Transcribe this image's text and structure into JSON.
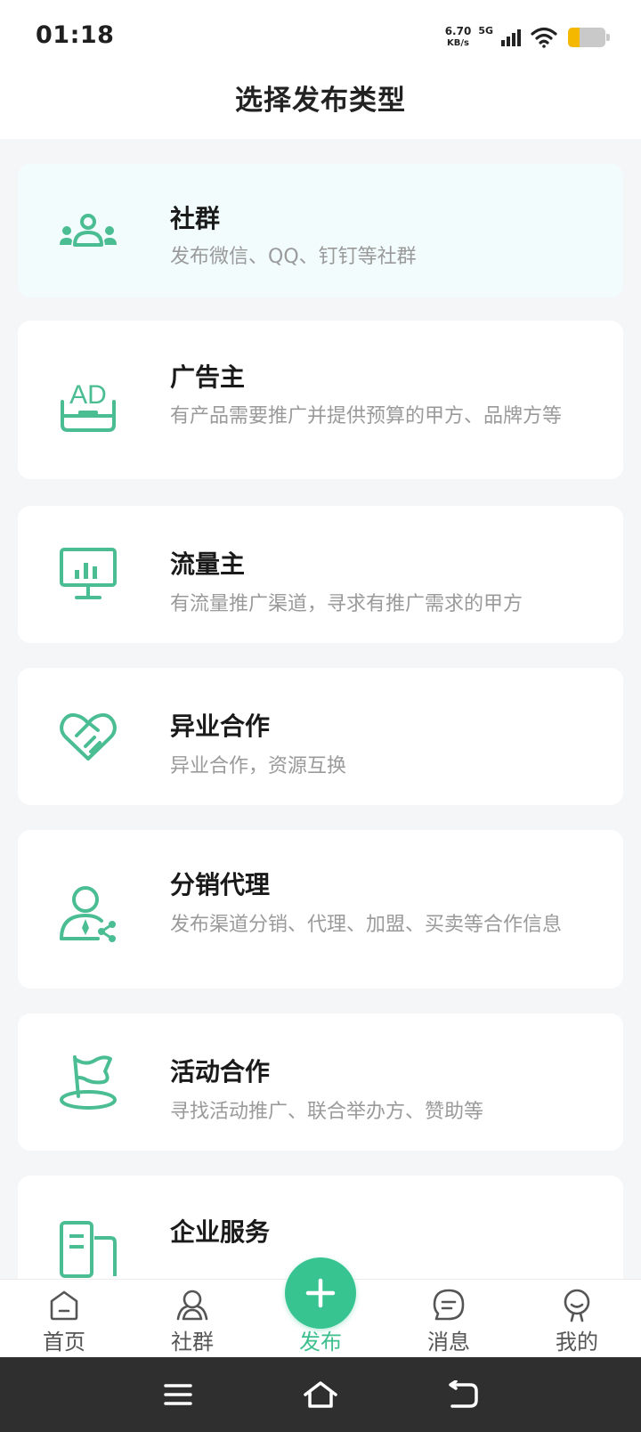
{
  "status_bar": {
    "time": "01:18",
    "net_speed_value": "6.70",
    "net_speed_unit": "KB/s",
    "network_type": "5G",
    "icons": [
      "signal-icon",
      "wifi-icon",
      "battery-icon"
    ]
  },
  "header": {
    "title": "选择发布类型"
  },
  "categories": [
    {
      "title": "社群",
      "desc": "发布微信、QQ、钉钉等社群",
      "icon": "community-icon",
      "selected": true
    },
    {
      "title": "广告主",
      "desc": "有产品需要推广并提供预算的甲方、品牌方等",
      "icon": "ad-icon",
      "selected": false
    },
    {
      "title": "流量主",
      "desc": "有流量推广渠道，寻求有推广需求的甲方",
      "icon": "monitor-chart-icon",
      "selected": false
    },
    {
      "title": "异业合作",
      "desc": "异业合作，资源互换",
      "icon": "handshake-heart-icon",
      "selected": false
    },
    {
      "title": "分销代理",
      "desc": "发布渠道分销、代理、加盟、买卖等合作信息",
      "icon": "agent-share-icon",
      "selected": false
    },
    {
      "title": "活动合作",
      "desc": "寻找活动推广、联合举办方、赞助等",
      "icon": "flag-icon",
      "selected": false
    },
    {
      "title": "企业服务",
      "desc": "",
      "icon": "enterprise-service-icon",
      "selected": false
    }
  ],
  "bottom_nav": {
    "items": [
      {
        "label": "首页",
        "icon": "home-icon"
      },
      {
        "label": "社群",
        "icon": "community-nav-icon"
      },
      {
        "label": "发布",
        "icon": "plus-icon",
        "active": true
      },
      {
        "label": "消息",
        "icon": "message-icon"
      },
      {
        "label": "我的",
        "icon": "profile-icon"
      }
    ]
  },
  "system_nav": {
    "icons": [
      "menu-icon",
      "home-key-icon",
      "back-icon"
    ]
  },
  "colors": {
    "accent": "#3dbf8e",
    "icon_green": "#4bbd93",
    "selected_card": "#f2fcfc",
    "page_bg": "#f5f6f7"
  }
}
